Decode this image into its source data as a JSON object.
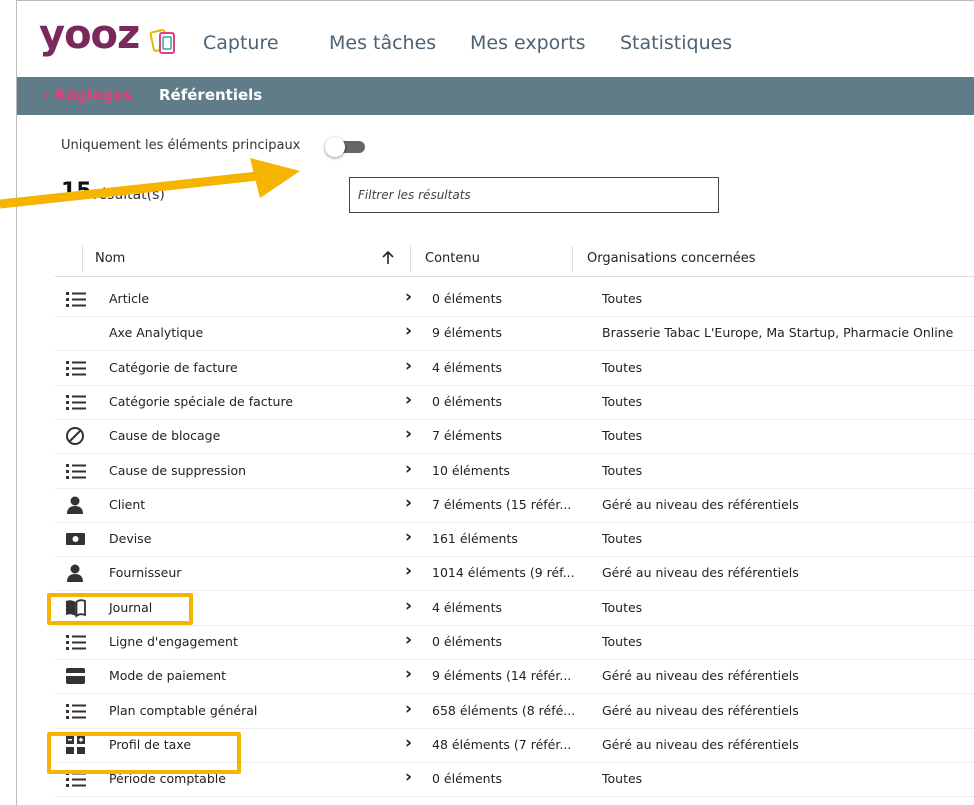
{
  "header": {
    "logo": "yooz",
    "nav": [
      "Capture",
      "Mes tâches",
      "Mes exports",
      "Statistiques"
    ]
  },
  "subbar": {
    "back": "‹ Réglages",
    "title": "Référentiels"
  },
  "toggle": {
    "label": "Uniquement les éléments principaux",
    "on": false
  },
  "results": {
    "count": "15",
    "label": "résultat(s)"
  },
  "filter": {
    "placeholder": "Filtrer les résultats"
  },
  "table": {
    "columns": [
      "Nom",
      "Contenu",
      "Organisations concernées"
    ],
    "sort_icon": "arrow-up-icon",
    "rows": [
      {
        "icon": "list-icon",
        "name": "Article",
        "content": "0 éléments",
        "orgs": "Toutes"
      },
      {
        "icon": "",
        "name": "Axe Analytique",
        "content": "9 éléments",
        "orgs": "Brasserie Tabac L'Europe, Ma Startup, Pharmacie Online"
      },
      {
        "icon": "list-icon",
        "name": "Catégorie de facture",
        "content": "4 éléments",
        "orgs": "Toutes"
      },
      {
        "icon": "list-icon",
        "name": "Catégorie spéciale de facture",
        "content": "0 éléments",
        "orgs": "Toutes"
      },
      {
        "icon": "block-icon",
        "name": "Cause de blocage",
        "content": "7 éléments",
        "orgs": "Toutes"
      },
      {
        "icon": "list-icon",
        "name": "Cause de suppression",
        "content": "10 éléments",
        "orgs": "Toutes"
      },
      {
        "icon": "person-icon",
        "name": "Client",
        "content": "7 éléments (15 référ...",
        "orgs": "Géré au niveau des référentiels"
      },
      {
        "icon": "money-icon",
        "name": "Devise",
        "content": "161 éléments",
        "orgs": "Toutes"
      },
      {
        "icon": "person-icon",
        "name": "Fournisseur",
        "content": "1014 éléments (9 réf...",
        "orgs": "Géré au niveau des référentiels"
      },
      {
        "icon": "book-icon",
        "name": "Journal",
        "content": "4 éléments",
        "orgs": "Toutes"
      },
      {
        "icon": "list-icon",
        "name": "Ligne d'engagement",
        "content": "0 éléments",
        "orgs": "Toutes"
      },
      {
        "icon": "card-icon",
        "name": "Mode de paiement",
        "content": "9 éléments (14 référ...",
        "orgs": "Géré au niveau des référentiels"
      },
      {
        "icon": "list-icon",
        "name": "Plan comptable général",
        "content": "658 éléments (8 réfé...",
        "orgs": "Géré au niveau des référentiels"
      },
      {
        "icon": "tax-grid-icon",
        "name": "Profil de taxe",
        "content": "48 éléments (7 référ...",
        "orgs": "Géré au niveau des référentiels"
      },
      {
        "icon": "list-icon",
        "name": "Période comptable",
        "content": "0 éléments",
        "orgs": "Toutes"
      }
    ]
  },
  "colors": {
    "brand": "#7a2a5a",
    "subbar": "#5f7c88",
    "back_link": "#e0407a",
    "highlight": "#f5b400"
  }
}
